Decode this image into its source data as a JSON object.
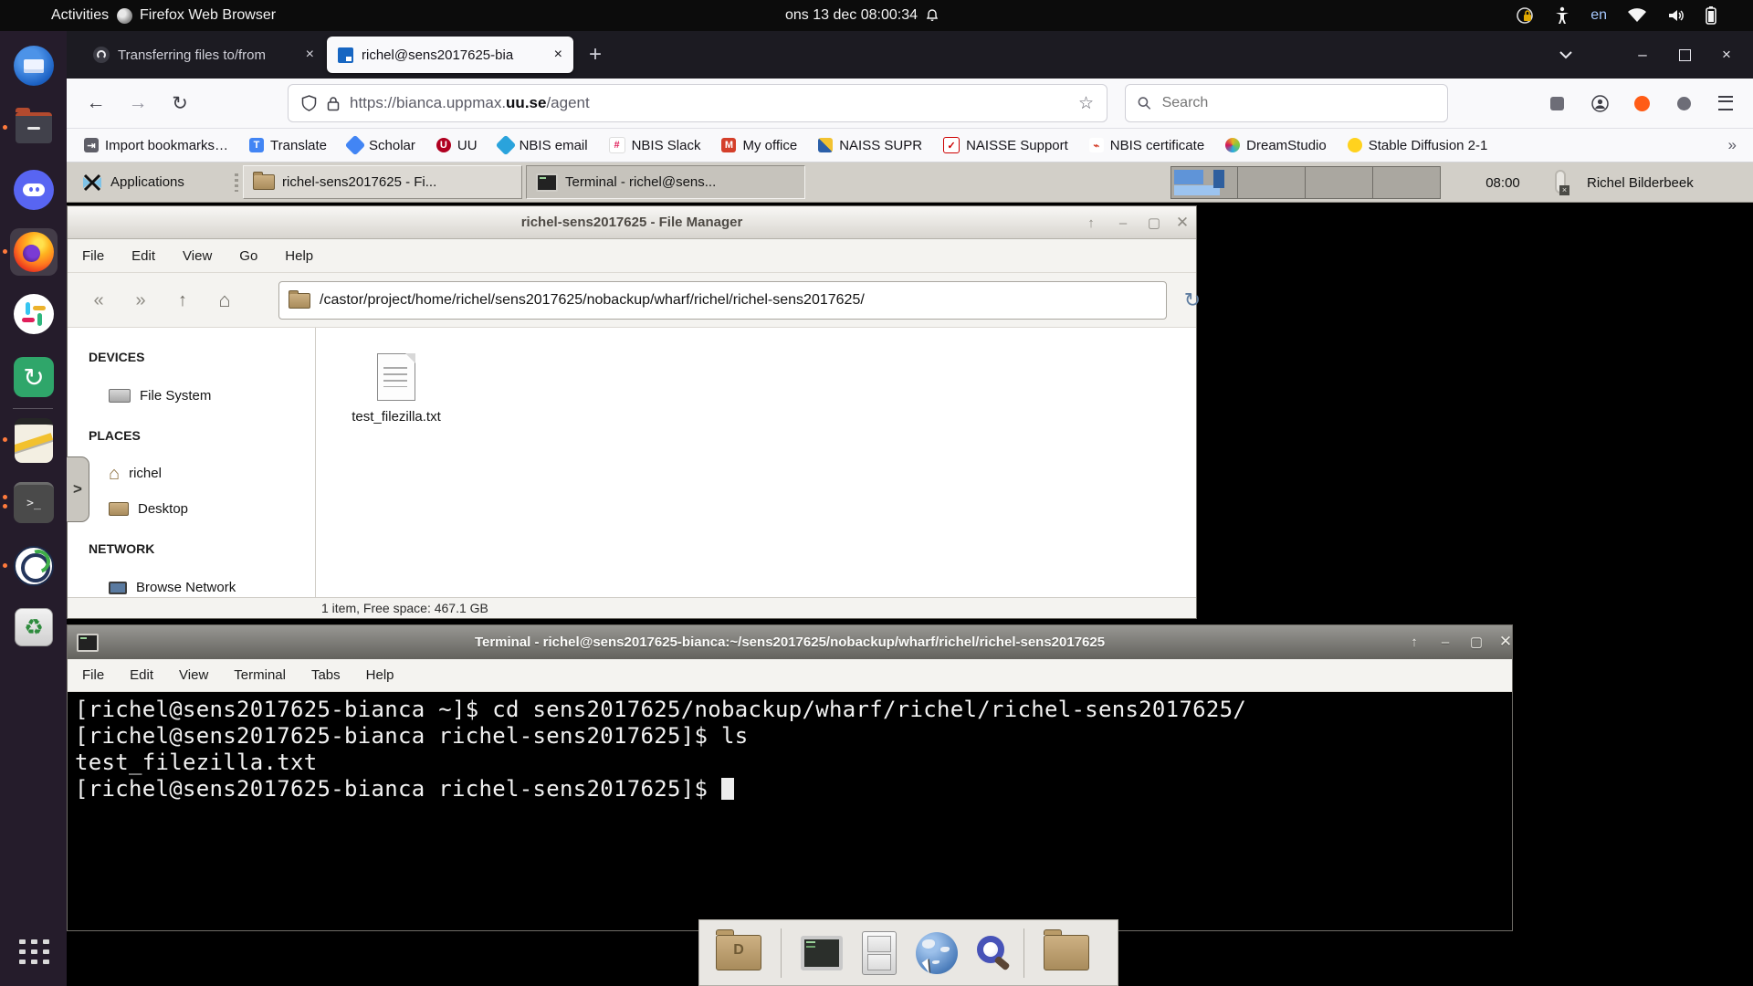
{
  "colors": {
    "ubuntu_orange": "#e95420",
    "running_dot": "#ff7a3c",
    "tab_active_bg": "#f9f9fb",
    "chrome_dark": "#1c1b22",
    "xfce_panel": "#d2cfc8",
    "terminal_bg": "#000000",
    "terminal_fg": "#f2f2f2",
    "folder_tan": "#b89c6e"
  },
  "topbar": {
    "activities_label": "Activities",
    "focused_app_label": "Firefox Web Browser",
    "clock": "ons 13 dec  08:00:34",
    "keyboard_layout": "en"
  },
  "browser": {
    "tabs": [
      {
        "title": "Transferring files to/from",
        "close": "×"
      },
      {
        "title": "richel@sens2017625-bia",
        "close": "×"
      }
    ],
    "new_tab_button": "+",
    "url_prefix": "https://bianca.uppmax.",
    "url_domain_bold": "uu.se",
    "url_suffix": "/agent",
    "star": "☆",
    "search_placeholder": "Search",
    "bookmarks": [
      "Import bookmarks…",
      "Translate",
      "Scholar",
      "UU",
      "NBIS email",
      "NBIS Slack",
      "My office",
      "NAISS SUPR",
      "NAISSE Support",
      "NBIS certificate",
      "DreamStudio",
      "Stable Diffusion 2-1"
    ],
    "bookmarks_overflow": "»"
  },
  "remote": {
    "taskbar": {
      "applications_label": "Applications",
      "task1": "richel-sens2017625 - Fi...",
      "task2": "Terminal - richel@sens...",
      "clock": "08:00",
      "user": "Richel Bilderbeek"
    },
    "file_manager": {
      "title": "richel-sens2017625 - File Manager",
      "menu": [
        "File",
        "Edit",
        "View",
        "Go",
        "Help"
      ],
      "path": "/castor/project/home/richel/sens2017625/nobackup/wharf/richel/richel-sens2017625/",
      "sidebar_sections": [
        {
          "header": "DEVICES",
          "items": [
            "File System"
          ]
        },
        {
          "header": "PLACES",
          "items": [
            "richel",
            "Desktop"
          ]
        },
        {
          "header": "NETWORK",
          "items": [
            "Browse Network"
          ]
        }
      ],
      "files": [
        "test_filezilla.txt"
      ],
      "statusbar": "1 item, Free space: 467.1 GB"
    },
    "terminal": {
      "title": "Terminal - richel@sens2017625-bianca:~/sens2017625/nobackup/wharf/richel/richel-sens2017625",
      "menu": [
        "File",
        "Edit",
        "View",
        "Terminal",
        "Tabs",
        "Help"
      ],
      "lines": [
        "[richel@sens2017625-bianca ~]$ cd sens2017625/nobackup/wharf/richel/richel-sens2017625/",
        "[richel@sens2017625-bianca richel-sens2017625]$ ls",
        "test_filezilla.txt",
        "[richel@sens2017625-bianca richel-sens2017625]$ "
      ]
    }
  }
}
